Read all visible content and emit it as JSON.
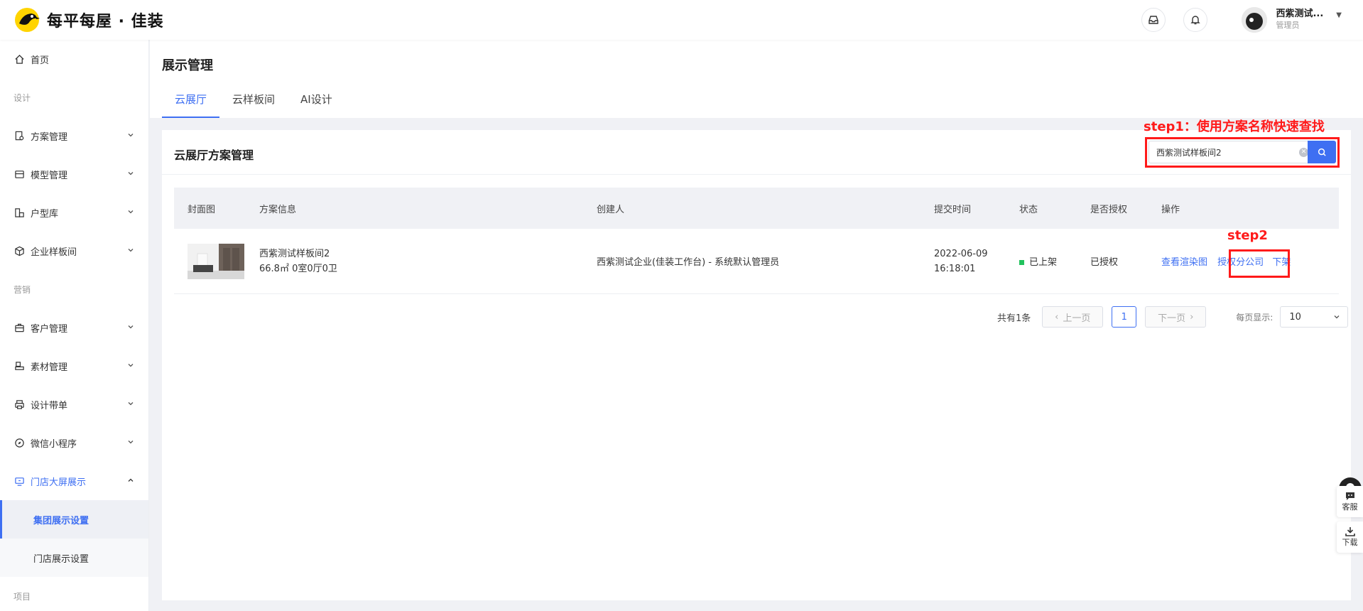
{
  "brand": {
    "name": "每平每屋 · 佳装"
  },
  "user": {
    "name": "西紫测试...",
    "role": "管理员"
  },
  "sidebar": {
    "items": [
      {
        "label": "首页"
      },
      {
        "group": "设计"
      },
      {
        "label": "方案管理"
      },
      {
        "label": "模型管理"
      },
      {
        "label": "户型库"
      },
      {
        "label": "企业样板间"
      },
      {
        "group": "营销"
      },
      {
        "label": "客户管理"
      },
      {
        "label": "素材管理"
      },
      {
        "label": "设计带单"
      },
      {
        "label": "微信小程序"
      },
      {
        "label": "门店大屏展示"
      },
      {
        "sub": "集团展示设置"
      },
      {
        "sub": "门店展示设置"
      },
      {
        "group": "项目"
      }
    ]
  },
  "page": {
    "title": "展示管理",
    "tabs": [
      "云展厅",
      "云样板间",
      "AI设计"
    ]
  },
  "card": {
    "title": "云展厅方案管理",
    "search_value": "西紫测试样板间2"
  },
  "annotations": {
    "step1": "step1：使用方案名称快速查找",
    "step2": "step2"
  },
  "table": {
    "headers": [
      "封面图",
      "方案信息",
      "创建人",
      "提交时间",
      "状态",
      "是否授权",
      "操作"
    ],
    "rows": [
      {
        "name": "西紫测试样板间2",
        "info": "66.8㎡ 0室0厅0卫",
        "creator": "西紫测试企业(佳装工作台) - 系统默认管理员",
        "date": "2022-06-09",
        "time": "16:18:01",
        "status": "已上架",
        "auth": "已授权",
        "ops": [
          "查看渲染图",
          "授权分公司",
          "下架"
        ]
      }
    ]
  },
  "pager": {
    "total": "共有1条",
    "prev": "上一页",
    "current": "1",
    "next": "下一页",
    "size_label": "每页显示:",
    "size_value": "10"
  },
  "float": {
    "service": "客服",
    "download": "下载"
  },
  "colors": {
    "accent": "#3e6ff2",
    "annotation": "#ff1a1a",
    "status_on": "#22c25d"
  }
}
